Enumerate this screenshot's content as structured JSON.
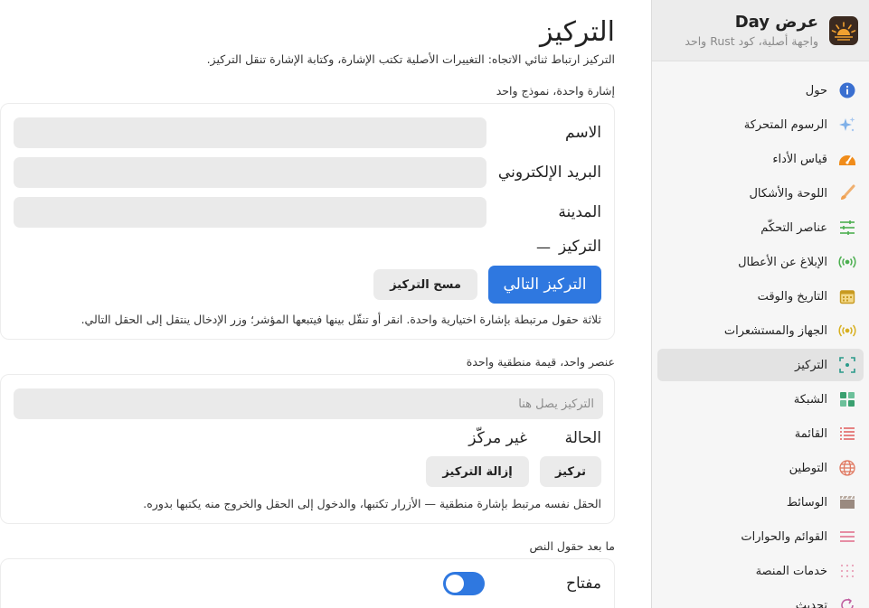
{
  "app": {
    "title": "عرض Day",
    "subtitle": "واجهة أصلية، كود Rust واحد"
  },
  "sidebar": {
    "items": [
      {
        "label": "حول",
        "icon": "info-icon",
        "color": "#3a6fd0"
      },
      {
        "label": "الرسوم المتحركة",
        "icon": "sparkles-icon",
        "color": "#7fb0e8"
      },
      {
        "label": "قياس الأداء",
        "icon": "speedometer-icon",
        "color": "#f08c1a"
      },
      {
        "label": "اللوحة والأشكال",
        "icon": "brush-icon",
        "color": "#f0b070"
      },
      {
        "label": "عناصر التحكّم",
        "icon": "sliders-icon",
        "color": "#4caf50"
      },
      {
        "label": "الإبلاغ عن الأعطال",
        "icon": "broadcast-icon",
        "color": "#4caf50"
      },
      {
        "label": "التاريخ والوقت",
        "icon": "calendar-icon",
        "color": "#c89a20"
      },
      {
        "label": "الجهاز والمستشعرات",
        "icon": "sensor-icon",
        "color": "#d8b020"
      },
      {
        "label": "التركيز",
        "icon": "focus-icon",
        "color": "#2a9a8a"
      },
      {
        "label": "الشبكة",
        "icon": "grid-icon",
        "color": "#3aa070"
      },
      {
        "label": "القائمة",
        "icon": "list-icon",
        "color": "#e05050"
      },
      {
        "label": "التوطين",
        "icon": "globe-icon",
        "color": "#e07860"
      },
      {
        "label": "الوسائط",
        "icon": "clapper-icon",
        "color": "#9a8a80"
      },
      {
        "label": "القوائم والحوارات",
        "icon": "menu-icon",
        "color": "#e06080"
      },
      {
        "label": "خدمات المنصة",
        "icon": "dots-grid-icon",
        "color": "#e080a0"
      },
      {
        "label": "تحديث",
        "icon": "refresh-icon",
        "color": "#c060a0"
      }
    ],
    "active_index": 8
  },
  "main": {
    "title": "التركيز",
    "description": "التركيز ارتباط ثنائي الاتجاه: التغييرات الأصلية تكتب الإشارة، وكتابة الإشارة تنقل التركيز.",
    "section1": {
      "label": "إشارة واحدة، نموذج واحد",
      "fields": [
        {
          "label": "الاسم",
          "value": ""
        },
        {
          "label": "البريد الإلكتروني",
          "value": ""
        },
        {
          "label": "المدينة",
          "value": ""
        }
      ],
      "focus_label": "التركيز",
      "focus_value": "—",
      "next_button": "التركيز التالي",
      "clear_button": "مسح التركيز",
      "hint": "ثلاثة حقول مرتبطة بإشارة اختيارية واحدة. انقر أو تنقّل بينها فيتبعها المؤشر؛ وزر الإدخال ينتقل إلى الحقل التالي."
    },
    "section2": {
      "label": "عنصر واحد، قيمة منطقية واحدة",
      "placeholder": "التركيز يصل هنا",
      "status_label": "الحالة",
      "status_value": "غير مركّز",
      "focus_button": "تركيز",
      "blur_button": "إزالة التركيز",
      "hint": "الحقل نفسه مرتبط بإشارة منطقية — الأزرار تكتبها، والدخول إلى الحقل والخروج منه يكتبها بدوره."
    },
    "section3": {
      "label": "ما بعد حقول النص",
      "switch_label": "مفتاح",
      "switch_on": true
    }
  }
}
